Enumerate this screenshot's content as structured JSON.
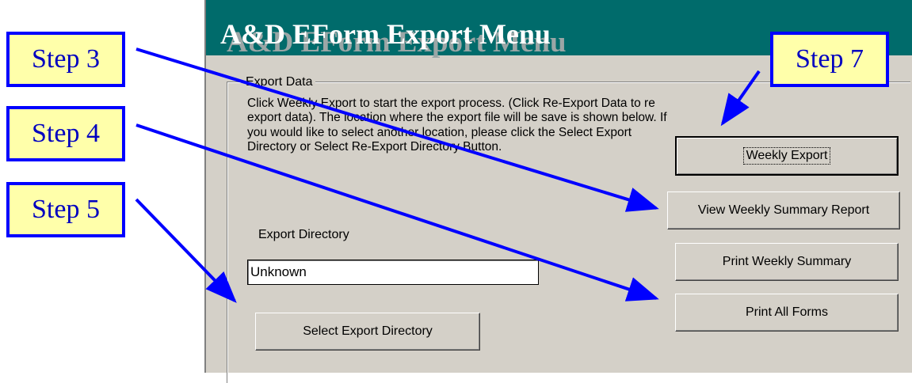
{
  "window": {
    "title": "A&D EForm Export Menu"
  },
  "export_group": {
    "label": "Export Data",
    "instructions": "Click Weekly Export to start the export process. (Click Re-Export Data to re export data). The location where the export file will be save is shown below. If you would like to select another location, please click the Select Export Directory or Select Re-Export Directory Button.",
    "directory_label": "Export Directory",
    "directory_value": "Unknown"
  },
  "buttons": {
    "weekly_export": "Weekly Export",
    "view_summary": "View Weekly Summary Report",
    "print_summary": "Print Weekly Summary",
    "print_forms": "Print All Forms",
    "select_directory": "Select Export Directory"
  },
  "callouts": {
    "step3": "Step 3",
    "step4": "Step 4",
    "step5": "Step 5",
    "step7": "Step 7"
  },
  "colors": {
    "title_bar": "#006b6b",
    "window_bg": "#d4d0c8",
    "callout_bg": "#ffffaa",
    "callout_border": "#0000ff",
    "arrow": "#0000ff"
  }
}
